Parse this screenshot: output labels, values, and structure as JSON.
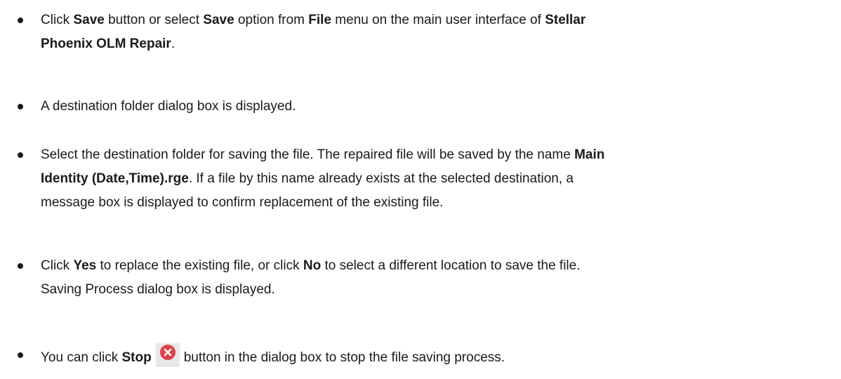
{
  "bullets": [
    {
      "line1_a": "Click ",
      "line1_b": "Save",
      "line1_c": " button or select ",
      "line1_d": "Save",
      "line1_e": " option from ",
      "line1_f": "File",
      "line1_g": " menu on the main user interface of ",
      "line1_h": "Stellar",
      "line2_a": "Phoenix OLM Repair",
      "line2_b": "."
    },
    {
      "text": "A destination folder dialog box is displayed."
    },
    {
      "line1_a": "Select the destination folder for saving the file. The repaired file will be saved by the name ",
      "line1_b": "Main",
      "line2_a": "Identity (Date,Time).rge",
      "line2_b": ". If a file by this name already exists at the selected destination, a",
      "line3": "message box is displayed to confirm replacement of the existing file."
    },
    {
      "line1_a": "Click ",
      "line1_b": "Yes",
      "line1_c": " to replace the existing file, or click ",
      "line1_d": "No",
      "line1_e": " to select a different location to save the file.",
      "line2": "Saving Process dialog box is displayed."
    },
    {
      "a": "You can click ",
      "b": "Stop",
      "icon": "stop-icon",
      "c": "button in the dialog box to stop the file saving process."
    }
  ],
  "colors": {
    "text": "#1a1a1a",
    "stop_icon": "#e0414a",
    "icon_bg": "#e8e8e8"
  }
}
